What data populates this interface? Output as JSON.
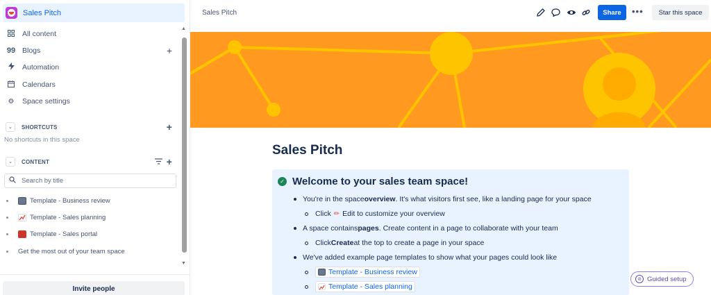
{
  "sidebar": {
    "space_name": "Sales Pitch",
    "nav": [
      {
        "label": "All content",
        "icon": "grid-icon"
      },
      {
        "label": "Blogs",
        "icon": "quote-icon"
      },
      {
        "label": "Automation",
        "icon": "lightning-icon"
      },
      {
        "label": "Calendars",
        "icon": "calendar-icon"
      },
      {
        "label": "Space settings",
        "icon": "gear-icon"
      }
    ],
    "shortcuts_heading": "SHORTCUTS",
    "shortcuts_empty": "No shortcuts in this space",
    "content_heading": "CONTENT",
    "search_placeholder": "Search by title",
    "tree": [
      {
        "label": "Template - Business review",
        "icon": "notebook-icon"
      },
      {
        "label": "Template - Sales planning",
        "icon": "chart-increasing-icon"
      },
      {
        "label": "Template - Sales portal",
        "icon": "briefcase-icon"
      },
      {
        "label": "Get the most out of your team space"
      }
    ],
    "invite_label": "Invite people"
  },
  "topbar": {
    "breadcrumb": "Sales Pitch",
    "share_label": "Share",
    "more_label": "•••",
    "star_label": "Star this space"
  },
  "main": {
    "title": "Sales Pitch",
    "panel_heading": "Welcome to your sales team space!",
    "items": [
      {
        "pre": "You're in the space ",
        "bold": "overview",
        "post": ". It's what visitors first see, like a landing page for your space"
      },
      {
        "pre": "Click ",
        "post": " Edit to customize your overview"
      },
      {
        "pre": "A space contains ",
        "bold": "pages",
        "post": ". Create content in a page to collaborate with your team"
      },
      {
        "pre": "Click ",
        "bold": "Create",
        "post": " at the top to create a page in your space"
      },
      {
        "pre": "We've added example page templates to show what your pages could look like"
      }
    ],
    "links": [
      {
        "label": "Template - Business review"
      },
      {
        "label": "Template - Sales planning"
      }
    ],
    "guided_setup": "Guided setup"
  },
  "colors": {
    "accent": "#0c66e4",
    "banner": "#ff991f",
    "banner_shapes": "#ffc400",
    "panel": "#e9f2ff",
    "space_logo": "#c13ad8"
  }
}
